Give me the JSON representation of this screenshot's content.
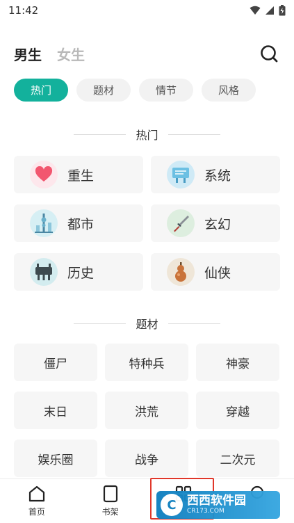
{
  "status_bar": {
    "time": "11:42"
  },
  "gender_tabs": [
    {
      "label": "男生",
      "active": true
    },
    {
      "label": "女生",
      "active": false
    }
  ],
  "filter_tabs": [
    {
      "label": "热门",
      "active": true
    },
    {
      "label": "题材",
      "active": false
    },
    {
      "label": "情节",
      "active": false
    },
    {
      "label": "风格",
      "active": false
    }
  ],
  "hot_section": {
    "title": "热门",
    "items": [
      {
        "label": "重生",
        "icon": "heart-icon"
      },
      {
        "label": "系统",
        "icon": "signboard-icon"
      },
      {
        "label": "都市",
        "icon": "city-tower-icon"
      },
      {
        "label": "玄幻",
        "icon": "sword-icon"
      },
      {
        "label": "历史",
        "icon": "bronze-ding-icon"
      },
      {
        "label": "仙侠",
        "icon": "gourd-icon"
      }
    ]
  },
  "topic_section": {
    "title": "题材",
    "items": [
      "僵尸",
      "特种兵",
      "神豪",
      "末日",
      "洪荒",
      "穿越",
      "娱乐圈",
      "战争",
      "二次元"
    ]
  },
  "bottom_nav": [
    {
      "label": "首页",
      "icon": "home-icon"
    },
    {
      "label": "书架",
      "icon": "bookshelf-icon"
    },
    {
      "label": "",
      "icon": "category-grid-icon"
    },
    {
      "label": "",
      "icon": "profile-icon"
    }
  ],
  "watermark": {
    "logo": "C",
    "title": "西西软件园",
    "subtitle": "CR173.COM"
  },
  "colors": {
    "accent": "#13b19c",
    "highlight_border": "#e0372a",
    "card_bg": "#f6f6f6"
  }
}
